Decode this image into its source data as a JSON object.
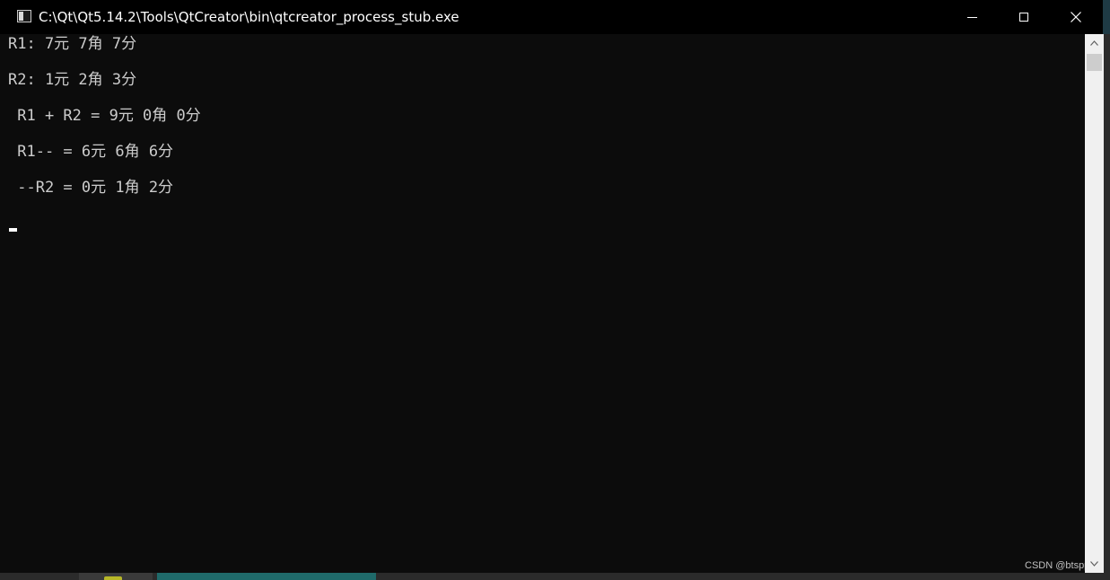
{
  "window": {
    "title": "C:\\Qt\\Qt5.14.2\\Tools\\QtCreator\\bin\\qtcreator_process_stub.exe",
    "icon": "console-window-icon",
    "controls": [
      "minimize-icon",
      "maximize-icon",
      "close-icon"
    ]
  },
  "console": {
    "lines": [
      "R1: 7元 7角 7分",
      "R2: 1元 2角 3分",
      " R1 + R2 = 9元 0角 0分",
      " R1-- = 6元 6角 6分",
      " --R2 = 0元 1角 2分"
    ]
  },
  "watermark": "CSDN @btsppp",
  "colors": {
    "console_bg": "#0c0c0c",
    "console_text": "#cccccc",
    "titlebar_bg": "#000000",
    "scrollbar_bg": "#f0f0f0"
  }
}
